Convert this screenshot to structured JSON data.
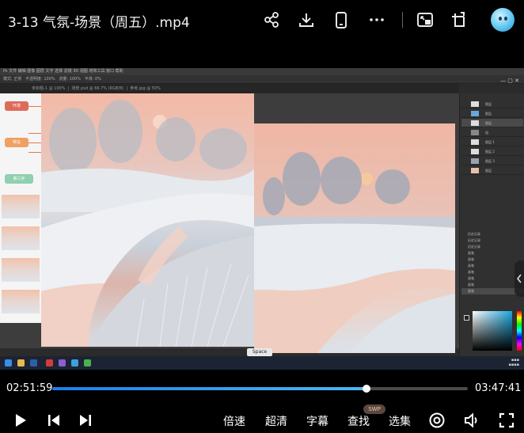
{
  "player": {
    "title": "3-13 气氛-场景（周五）.mp4",
    "current_time": "02:51:59",
    "total_time": "03:47:41",
    "progress": 0.757,
    "accent_color": "#3aa5ee",
    "buttons": {
      "speed": "倍速",
      "quality": "超清",
      "subtitle": "字幕",
      "search": "查找",
      "search_badge": "SWP",
      "episodes": "选集"
    },
    "top_icons": [
      "share-icon",
      "download-icon",
      "phone-icon",
      "more-icon",
      "picture-in-picture-icon",
      "rotate-screen-icon",
      "avatar"
    ],
    "bottom_icons": [
      "play-icon",
      "previous-icon",
      "next-icon",
      "danmaku-icon",
      "volume-icon",
      "fullscreen-icon"
    ]
  },
  "video_frame": {
    "app": "Photoshop",
    "tooltip": "Space",
    "mindmap_nodes": [
      "环境",
      "特征",
      "第三步"
    ],
    "mindmap_colors": [
      "#e06a5a",
      "#f0a060",
      "#8fd0b0"
    ],
    "layers": [
      "图层",
      "图层",
      "图层",
      "组",
      "图层 1",
      "图层 2",
      "图层 3",
      "图层"
    ],
    "history_items": [
      "历史记录",
      "历史记录",
      "历史记录",
      "画笔",
      "画笔",
      "画笔",
      "画笔",
      "画笔",
      "画笔",
      "画笔"
    ],
    "picker_hue_color": "#1ea8e0"
  }
}
